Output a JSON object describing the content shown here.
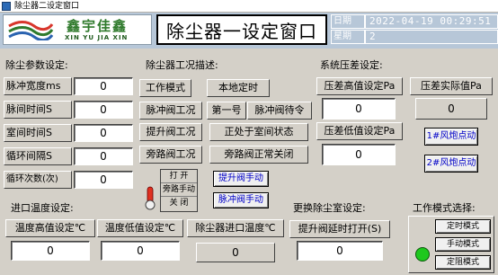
{
  "window": {
    "title": "除尘器二设定窗口"
  },
  "logo": {
    "cn": "鑫宇佳鑫",
    "en": "XIN YU JIA XIN"
  },
  "page_title": "除尘器一设定窗口",
  "datetime": {
    "date_label": "日期",
    "date_value": "2022-04-19 00:29:51",
    "week_label": "星期",
    "week_value": "2"
  },
  "params": {
    "heading": "除尘参数设定:",
    "rows": [
      {
        "label": "脉冲宽度ms",
        "value": "0"
      },
      {
        "label": "脉间时间S",
        "value": "0"
      },
      {
        "label": "室间时间S",
        "value": "0"
      },
      {
        "label": "循环间隔S",
        "value": "0"
      },
      {
        "label": "循环次数(次)",
        "value": "0"
      }
    ]
  },
  "status": {
    "heading": "除尘器工况描述:",
    "work_mode_label": "工作模式",
    "work_mode_value": "本地定时",
    "pulse_label": "脉冲阀工况",
    "pulse_index": "第一号",
    "pulse_state": "脉冲阀待令",
    "lift_label": "提升阀工况",
    "lift_state": "正处于室间状态",
    "bypass_label": "旁路阀工况",
    "bypass_state": "旁路阀正常关闭"
  },
  "switch": {
    "open": "打 开",
    "manual": "旁路手动",
    "close": "关 闭"
  },
  "manual_buttons": {
    "lift": "提升阀手动",
    "pulse": "脉冲阀手动"
  },
  "pressure": {
    "heading": "系统压差设定:",
    "high_label": "压差高值设定Pa",
    "high_value": "0",
    "actual_label": "压差实际值Pa",
    "actual_value": "0",
    "low_label": "压差低值设定Pa",
    "low_value": "0",
    "fan1": "1#风炮点动",
    "fan2": "2#风炮点动"
  },
  "inlet_temp": {
    "heading": "进口温度设定:",
    "high_label": "温度高值设定℃",
    "high_value": "0",
    "low_label": "温度低值设定℃",
    "low_value": "0",
    "actual_label": "除尘器进口温度℃",
    "actual_value": "0"
  },
  "room_change": {
    "heading": "更换除尘室设定:",
    "delay_label": "提升阀延时打开(S)",
    "delay_value": "0"
  },
  "mode_select": {
    "heading": "工作模式选择:",
    "timed": "定时模式",
    "manual": "手动模式",
    "fixed": "定阻模式"
  },
  "colors": {
    "header_bg": "#b7c7d8",
    "panel_bg": "#d4d0c8",
    "button_text": "#0000c8",
    "indicator": "#1ec81e"
  }
}
